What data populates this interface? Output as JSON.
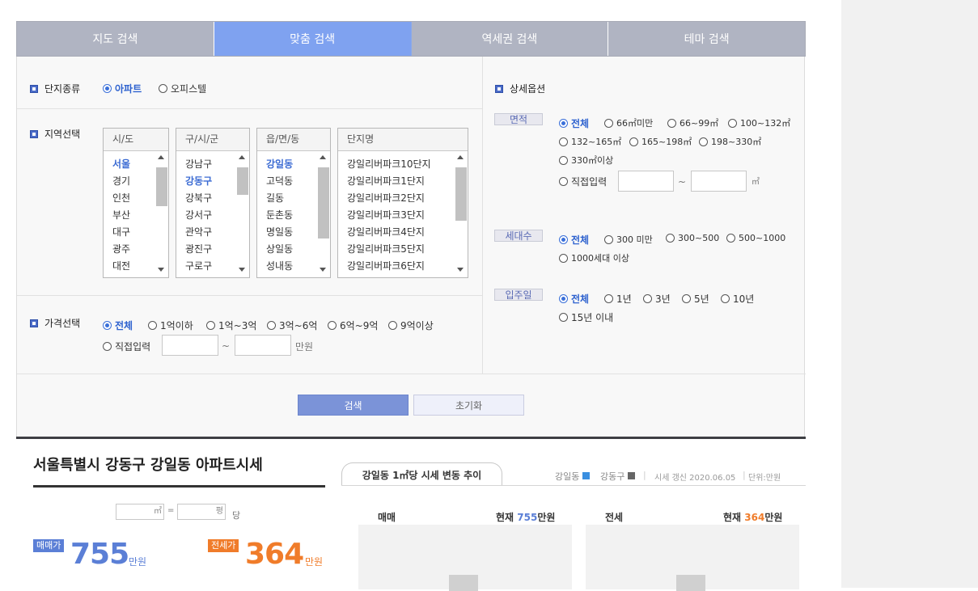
{
  "tabs": [
    "지도 검색",
    "맞춤 검색",
    "역세권 검색",
    "테마 검색"
  ],
  "complex_type": {
    "title": "단지종류",
    "options": [
      "아파트",
      "오피스텔"
    ],
    "selected": "아파트"
  },
  "region": {
    "title": "지역선택",
    "sido": {
      "header": "시/도",
      "items": [
        "서울",
        "경기",
        "인천",
        "부산",
        "대구",
        "광주",
        "대전"
      ],
      "selected": "서울"
    },
    "gu": {
      "header": "구/시/군",
      "items": [
        "강남구",
        "강동구",
        "강북구",
        "강서구",
        "관악구",
        "광진구",
        "구로구"
      ],
      "selected": "강동구"
    },
    "dong": {
      "header": "읍/면/동",
      "items": [
        "강일동",
        "고덕동",
        "길동",
        "둔촌동",
        "명일동",
        "상일동",
        "성내동"
      ],
      "selected": "강일동"
    },
    "complex": {
      "header": "단지명",
      "items": [
        "강일리버파크10단지",
        "강일리버파크1단지",
        "강일리버파크2단지",
        "강일리버파크3단지",
        "강일리버파크4단지",
        "강일리버파크5단지",
        "강일리버파크6단지"
      ]
    }
  },
  "price": {
    "title": "가격선택",
    "options": [
      "전체",
      "1억이하",
      "1억~3억",
      "3억~6억",
      "6억~9억",
      "9억이상"
    ],
    "selected": "전체",
    "direct": "직접입력",
    "tilde": "~",
    "unit": "만원"
  },
  "detail": {
    "title": "상세옵션",
    "area": {
      "label": "면적",
      "options": [
        "전체",
        "66㎡미만",
        "66~99㎡",
        "100~132㎡",
        "132~165㎡",
        "165~198㎡",
        "198~330㎡",
        "330㎡이상"
      ],
      "direct": "직접입력",
      "tilde": "~",
      "unit": "㎡"
    },
    "households": {
      "label": "세대수",
      "options": [
        "전체",
        "300 미만",
        "300~500",
        "500~1000",
        "1000세대 이상"
      ]
    },
    "movein": {
      "label": "입주일",
      "options": [
        "전체",
        "1년",
        "3년",
        "5년",
        "10년",
        "15년 이내"
      ]
    }
  },
  "buttons": {
    "search": "검색",
    "reset": "초기화"
  },
  "result": {
    "title": "서울특별시 강동구 강일동 아파트시세",
    "conv": {
      "m2": "㎡",
      "eq": "=",
      "pyeong": "평",
      "per": "당"
    },
    "sale": {
      "badge": "매매가",
      "value": "755",
      "unit": "만원"
    },
    "jeonse": {
      "badge": "전세가",
      "value": "364",
      "unit": "만원"
    }
  },
  "chart": {
    "tab_title": "강일동 1㎡당 시세 변동 추이",
    "legend_dong": "강일동",
    "legend_gu": "강동구",
    "updated": "시세 갱신 2020.06.05",
    "unit": "단위:만원",
    "sale_label": "매매",
    "jeonse_label": "전세",
    "current": "현재",
    "sale_value": "755",
    "jeonse_value": "364",
    "unit_short": "만원"
  },
  "colors": {
    "accent": "#3a6fd9",
    "tab_active": "#7fa2f0",
    "sale": "#5b7fd6",
    "jeonse": "#f07c2a"
  }
}
